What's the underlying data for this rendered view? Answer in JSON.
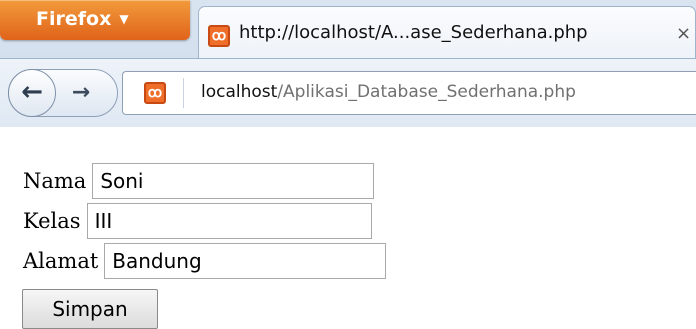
{
  "browser": {
    "menu_button": "Firefox",
    "menu_arrow_icon": "triangle-down-icon",
    "tab": {
      "favicon": "xampp-icon",
      "title": "http://localhost/A...ase_Sederhana.php",
      "close_icon": "close-icon",
      "close_glyph": "×"
    },
    "nav": {
      "back_icon": "back-arrow-icon",
      "back_glyph": "←",
      "forward_icon": "forward-arrow-icon",
      "forward_glyph": "→"
    },
    "address": {
      "favicon": "xampp-icon",
      "host": "localhost",
      "path": "/Aplikasi_Database_Sederhana.php"
    }
  },
  "form": {
    "nama": {
      "label": "Nama",
      "value": "Soni"
    },
    "kelas": {
      "label": "Kelas",
      "value": "III"
    },
    "alamat": {
      "label": "Alamat",
      "value": "Bandung"
    },
    "submit_label": "Simpan"
  },
  "colors": {
    "firefox_button": "#e0631a",
    "chrome_bg": "#d4e0ee",
    "favicon": "#ef6f2a"
  }
}
